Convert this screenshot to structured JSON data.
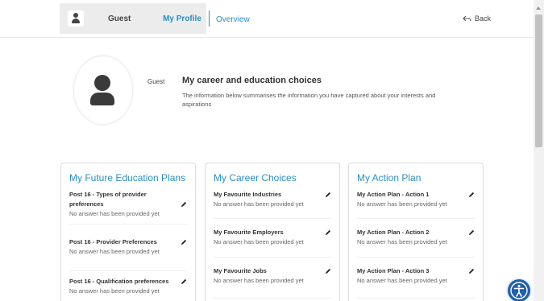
{
  "header": {
    "guest_name": "Guest",
    "tabs": [
      {
        "label": "My Profile",
        "active": true
      },
      {
        "label": "Overview",
        "active": false
      }
    ],
    "back_label": "Back"
  },
  "profile": {
    "name": "Guest",
    "title": "My career and education choices",
    "description": "The information below summarises the information you have captured about your interests and aspirations"
  },
  "cards": [
    {
      "title": "My Future Education Plans",
      "items": [
        {
          "title": "Post 16 - Types of provider preferences",
          "status": "No answer has been provided yet"
        },
        {
          "title": "Post 16 - Provider Preferences",
          "status": "No answer has been provided yet"
        },
        {
          "title": "Post 16 - Qualification preferences",
          "status": "No answer has been provided yet"
        }
      ]
    },
    {
      "title": "My Career Choices",
      "items": [
        {
          "title": "My Favourite Industries",
          "status": "No answer has been provided yet"
        },
        {
          "title": "My Favourite Employers",
          "status": "No answer has been provided yet"
        },
        {
          "title": "My Favourite Jobs",
          "status": "No answer has been provided yet"
        }
      ]
    },
    {
      "title": "My Action Plan",
      "items": [
        {
          "title": "My Action Plan - Action 1",
          "status": "No answer has been provided yet"
        },
        {
          "title": "My Action Plan - Action 2",
          "status": "No answer has been provided yet"
        },
        {
          "title": "My Action Plan - Action 3",
          "status": "No answer has been provided yet"
        }
      ]
    }
  ],
  "icons": {
    "user": "user-icon",
    "back": "back-arrow-icon",
    "edit": "pencil-icon",
    "accessibility": "accessibility-icon"
  },
  "colors": {
    "accent": "#2a8fc5",
    "accessibility_button": "#1f5fae",
    "nav_highlight": "#ececec"
  }
}
